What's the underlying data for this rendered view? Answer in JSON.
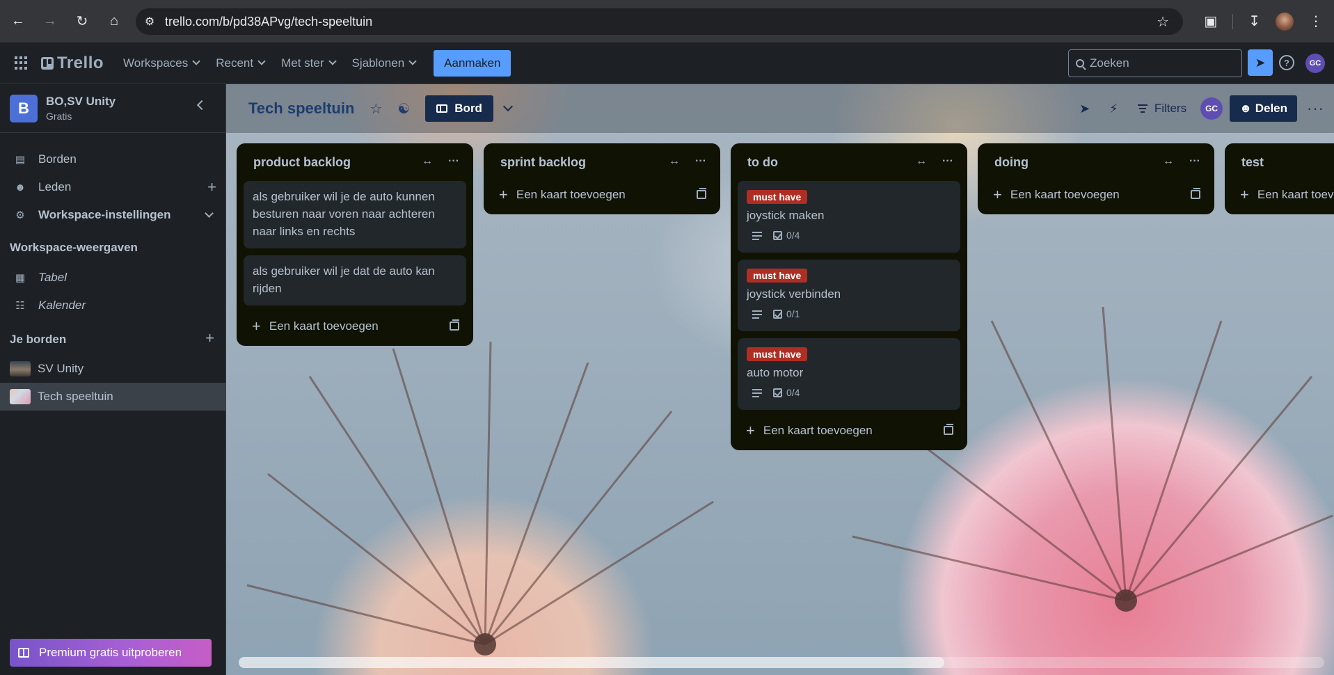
{
  "browser": {
    "url": "trello.com/b/pd38APvg/tech-speeltuin"
  },
  "header": {
    "logo": "Trello",
    "menu": [
      "Workspaces",
      "Recent",
      "Met ster",
      "Sjablonen"
    ],
    "create": "Aanmaken",
    "search_placeholder": "Zoeken",
    "avatar": "GC",
    "help": "?"
  },
  "sidebar": {
    "workspace_initial": "B",
    "workspace_name": "BO,SV Unity",
    "plan": "Gratis",
    "items": [
      {
        "label": "Borden"
      },
      {
        "label": "Leden"
      },
      {
        "label": "Workspace-instellingen"
      }
    ],
    "views_heading": "Workspace-weergaven",
    "views": [
      {
        "label": "Tabel"
      },
      {
        "label": "Kalender"
      }
    ],
    "boards_heading": "Je borden",
    "boards": [
      {
        "label": "SV Unity"
      },
      {
        "label": "Tech speeltuin"
      }
    ],
    "premium": "Premium gratis uitproberen"
  },
  "board": {
    "title": "Tech speeltuin",
    "view": "Bord",
    "filters": "Filters",
    "avatar": "GC",
    "share": "Delen",
    "scroll_fraction": 0.65,
    "lists": [
      {
        "title": "product backlog",
        "cards": [
          {
            "text": "als gebruiker wil je de auto kunnen besturen naar voren naar achteren naar links en rechts"
          },
          {
            "text": "als gebruiker wil je dat de auto kan rijden"
          }
        ],
        "add": "Een kaart toevoegen"
      },
      {
        "title": "sprint backlog",
        "cards": [],
        "add": "Een kaart toevoegen"
      },
      {
        "title": "to do",
        "cards": [
          {
            "label": "must have",
            "text": "joystick maken",
            "checklist": "0/4"
          },
          {
            "label": "must have",
            "text": "joystick verbinden",
            "checklist": "0/1"
          },
          {
            "label": "must have",
            "text": "auto motor",
            "checklist": "0/4"
          }
        ],
        "add": "Een kaart toevoegen"
      },
      {
        "title": "doing",
        "cards": [],
        "add": "Een kaart toevoegen"
      },
      {
        "title": "test",
        "cards": [],
        "add": "Een kaart toevoegen"
      }
    ]
  },
  "colors": {
    "accent": "#579dff",
    "label_red": "#ae2e24",
    "list_bg": "#101204",
    "card_bg": "#22272b"
  }
}
